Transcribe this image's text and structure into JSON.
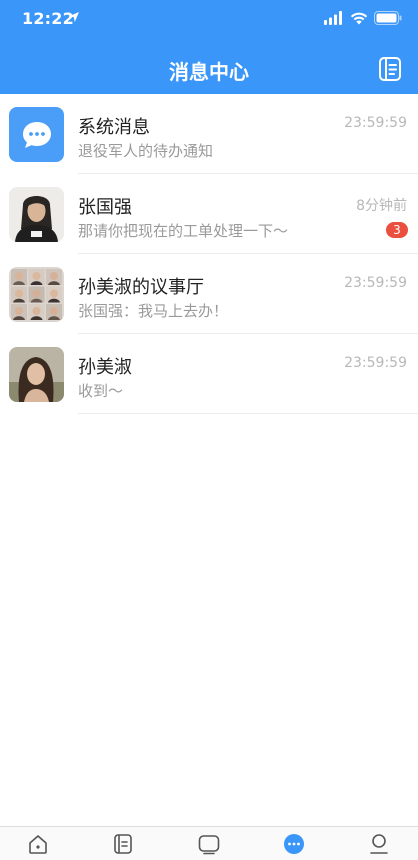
{
  "status_bar": {
    "time": "12:22"
  },
  "header": {
    "title": "消息中心"
  },
  "messages": [
    {
      "name": "系统消息",
      "preview": "退役军人的待办通知",
      "time": "23:59:59",
      "badge": ""
    },
    {
      "name": "张国强",
      "preview": "那请你把现在的工单处理一下～",
      "time": "8分钟前",
      "badge": "3"
    },
    {
      "name": "孙美淑的议事厅",
      "preview": "张国强：我马上去办！",
      "time": "23:59:59",
      "badge": ""
    },
    {
      "name": "孙美淑",
      "preview": "收到～",
      "time": "23:59:59",
      "badge": ""
    }
  ],
  "tabbar": {
    "tabs": [
      {
        "icon": "home-icon"
      },
      {
        "icon": "notes-icon"
      },
      {
        "icon": "tv-icon"
      },
      {
        "icon": "messages-icon"
      },
      {
        "icon": "profile-icon"
      }
    ],
    "active_index": 3
  },
  "colors": {
    "primary": "#3a96f8",
    "badge": "#ea4f3f"
  }
}
